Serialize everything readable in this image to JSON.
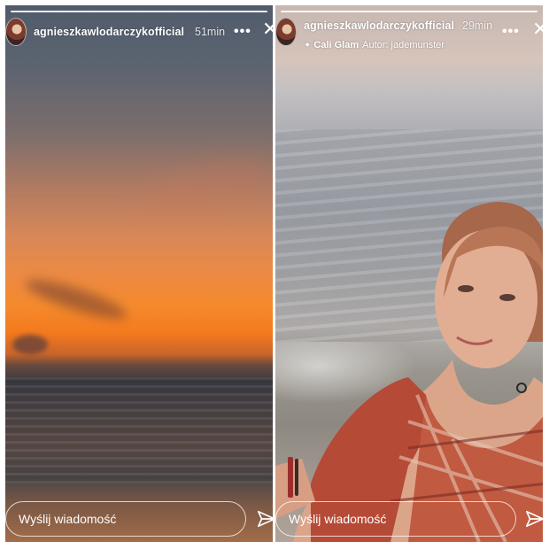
{
  "stories": [
    {
      "username": "agnieszkawlodarczykofficial",
      "time": "51min",
      "more_label": "•••",
      "close_label": "✕",
      "reply_placeholder": "Wyślij wiadomość"
    },
    {
      "username": "agnieszkawlodarczykofficial",
      "time": "29min",
      "more_label": "•••",
      "close_label": "✕",
      "music": {
        "sparkle": "✦",
        "song": "Cali Glam",
        "author": "Autor: jademunster"
      },
      "reply_placeholder": "Wyślij wiadomość"
    }
  ],
  "colors": {
    "text": "#ffffff",
    "sunset_orange": "#f58a2c"
  }
}
